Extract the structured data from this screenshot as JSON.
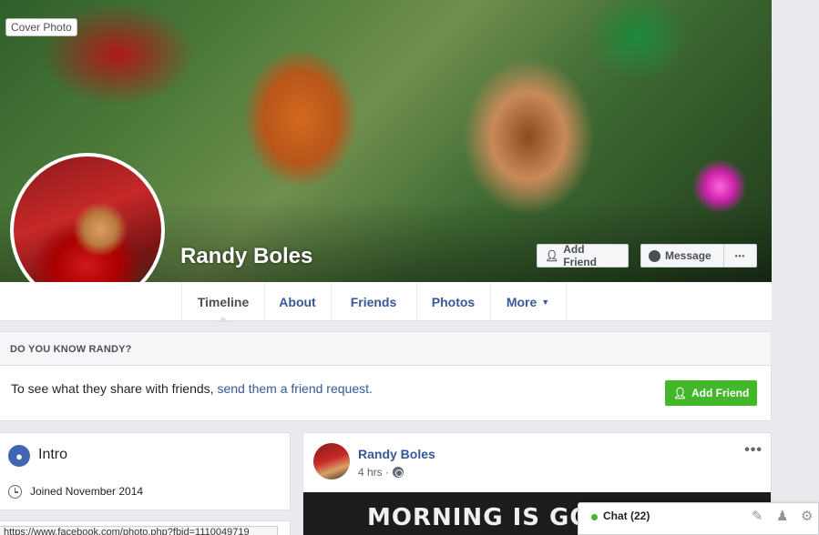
{
  "cover": {
    "label": "Cover Photo"
  },
  "profile": {
    "name": "Randy Boles"
  },
  "actions": {
    "add_friend": "Add Friend",
    "message": "Message",
    "more": "•••"
  },
  "nav": {
    "tabs": [
      {
        "label": "Timeline"
      },
      {
        "label": "About"
      },
      {
        "label": "Friends"
      },
      {
        "label": "Photos"
      },
      {
        "label": "More"
      }
    ]
  },
  "know": {
    "heading": "DO YOU KNOW RANDY?",
    "text": "To see what they share with friends,",
    "link": "send them a friend request.",
    "button": "Add Friend"
  },
  "intro": {
    "title": "Intro",
    "joined": "Joined November 2014"
  },
  "status_url": "https://www.facebook.com/photo.php?fbid=1110049719",
  "post": {
    "author": "Randy Boles",
    "time": "4 hrs ·",
    "menu": "•••",
    "image_text": "MORNING IS GOD"
  },
  "chat": {
    "label": "Chat (22)"
  },
  "colors": {
    "link": "#365899",
    "green": "#42b72a",
    "bg": "#e9ebee"
  }
}
